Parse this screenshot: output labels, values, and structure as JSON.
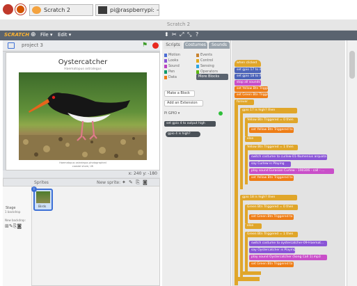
{
  "taskbar": {
    "task1": "Scratch 2",
    "task2": "pi@raspberrypi: ~"
  },
  "window": {
    "title": "Scratch 2"
  },
  "menubar": {
    "logo": "SCRATCH",
    "file": "File ▾",
    "edit": "Edit ▾"
  },
  "stage": {
    "project_name": "project 3",
    "slide_title": "Oystercatcher",
    "slide_subtitle": "Haematopus ostralegus",
    "caption_line1": "Haematopus ostralegus photographed",
    "caption_line2": "coastal shore, UK",
    "coords": "x: 240  y: -180"
  },
  "sprites": {
    "header": "Sprites",
    "new_sprite": "New sprite:",
    "stage_label": "Stage",
    "stage_sub": "1 backdrop",
    "new_backdrop": "New backdrop:",
    "sprite_name": "Birds",
    "sprite_badge": "i"
  },
  "tabs": {
    "scripts": "Scripts",
    "costumes": "Costumes",
    "sounds": "Sounds"
  },
  "categories": {
    "motion": "Motion",
    "looks": "Looks",
    "sound": "Sound",
    "pen": "Pen",
    "data": "Data",
    "events": "Events",
    "control": "Control",
    "sensing": "Sensing",
    "operators": "Operators",
    "more_blocks": "More Blocks"
  },
  "palette": {
    "make_block": "Make a Block",
    "add_extension": "Add an Extension",
    "gpio_label": "Pi GPIO ▾",
    "gpio_block1": "set gpio 4 to output high",
    "gpio_block2": "gpio 4 is high?"
  },
  "script": {
    "hat": "when clicked",
    "s1": "set gpio 17 to input",
    "s2": "set gpio 18 to input",
    "s3": "stop all sounds",
    "s4": "set Yellow Btn Triggered to 0",
    "s5": "set Green Btn Triggered to 0",
    "forever": "forever",
    "if1": "gpio 17 is high? then",
    "if1a": "Yellow Btn Triggered = 0 then",
    "set1": "set Yellow Btn Triggered to 1",
    "else1": "else",
    "if1b": "Yellow Btn Triggered = 1 then",
    "cost1": "switch costume to curlew-01-Numenius arquata",
    "say1": "say Curlew is Playing",
    "play1": "play sound Eurasian Curlew - 190306 - call - ...",
    "set2": "set Yellow Btn Triggered to 0",
    "if2": "gpio 18 is high? then",
    "if2a": "Green Btn Triggered = 0 then",
    "set3": "set Green Btn Triggered to 1",
    "else2": "else",
    "if2b": "Green Btn Triggered = 1 then",
    "cost2": "switch costume to oystercatcher-09-Haemat...",
    "say2": "say Oystercatcher is Playing",
    "play2": "play sound Oystercatcher (Song Call 1).mp3",
    "set4": "set Green Btn Triggered to 0"
  },
  "colors": {
    "menubar": "#5a636f",
    "control": "#e0a62a",
    "data": "#e0a62a",
    "gpio": "#4b63b8",
    "looks": "#8a55d7",
    "sound": "#c94fc9",
    "events": "#e0a62a"
  }
}
